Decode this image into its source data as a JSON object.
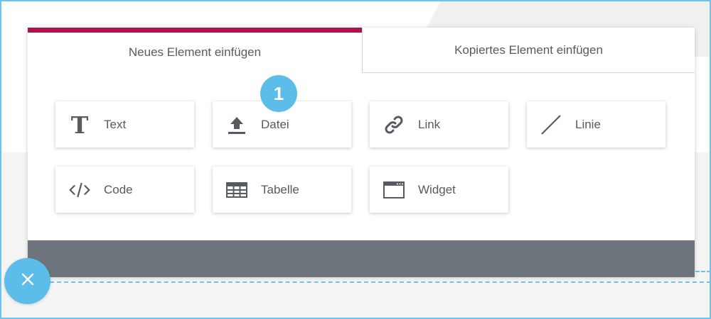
{
  "tabs": [
    {
      "label": "Neues Element einfügen",
      "active": true
    },
    {
      "label": "Kopiertes Element einfügen",
      "active": false
    }
  ],
  "elements": [
    {
      "label": "Text",
      "icon": "text-icon"
    },
    {
      "label": "Datei",
      "icon": "upload-icon"
    },
    {
      "label": "Link",
      "icon": "link-icon"
    },
    {
      "label": "Linie",
      "icon": "line-icon"
    },
    {
      "label": "Code",
      "icon": "code-icon"
    },
    {
      "label": "Tabelle",
      "icon": "table-icon"
    },
    {
      "label": "Widget",
      "icon": "widget-icon"
    }
  ],
  "step_badge": {
    "number": "1"
  },
  "close_button": {
    "icon": "close-icon"
  },
  "colors": {
    "accent": "#b0124e",
    "highlight": "#5cbdea",
    "footer": "#6e757c",
    "text": "#555b61",
    "frame": "#6ec3ec"
  }
}
